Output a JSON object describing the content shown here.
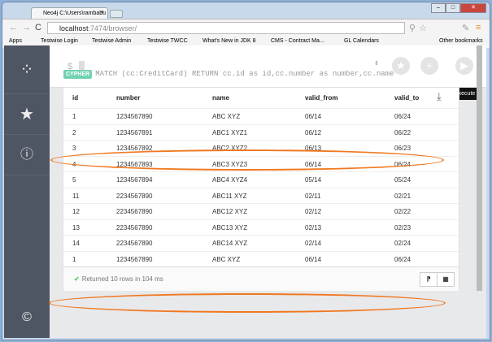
{
  "browser": {
    "tab_title": "Neo4j C:\\Users\\rambabu",
    "url_host": "localhost",
    "url_path": ":7474/browser/",
    "bookmarks": [
      "Apps",
      "Testwise Login",
      "Testwise Admin",
      "Testwise TWCC",
      "What's New in JDK 8",
      "CMS - Contract Ma...",
      "GL Calendars",
      "Other bookmarks"
    ]
  },
  "editor": {
    "prompt": "$",
    "tooltip": "Execute"
  },
  "query": {
    "badge": "CYPHER",
    "text": "MATCH (cc:CreditCard) RETURN cc.id as id,cc.number as number,cc.name"
  },
  "table": {
    "columns": [
      "id",
      "number",
      "name",
      "valid_from",
      "valid_to"
    ],
    "rows": [
      [
        "1",
        "1234567890",
        "ABC XYZ",
        "06/14",
        "06/24"
      ],
      [
        "2",
        "1234567891",
        "ABC1 XYZ1",
        "06/12",
        "06/22"
      ],
      [
        "3",
        "1234567892",
        "ABC2 XYZ2",
        "06/13",
        "06/23"
      ],
      [
        "4",
        "1234567893",
        "ABC3 XYZ3",
        "06/14",
        "06/24"
      ],
      [
        "5",
        "1234567894",
        "ABC4 XYZ4",
        "05/14",
        "05/24"
      ],
      [
        "11",
        "2234567890",
        "ABC11 XYZ",
        "02/11",
        "02/21"
      ],
      [
        "12",
        "2234567890",
        "ABC12 XYZ",
        "02/12",
        "02/22"
      ],
      [
        "13",
        "2234567890",
        "ABC13 XYZ",
        "02/13",
        "02/23"
      ],
      [
        "14",
        "2234567890",
        "ABC14 XYZ",
        "02/14",
        "02/24"
      ],
      [
        "1",
        "1234567890",
        "ABC XYZ",
        "06/14",
        "06/24"
      ]
    ]
  },
  "status": {
    "text": "Returned 10 rows in 104 ms"
  },
  "colors": {
    "accent": "#72d2b0",
    "highlight": "#f07820",
    "sidebar": "#4e5563"
  }
}
